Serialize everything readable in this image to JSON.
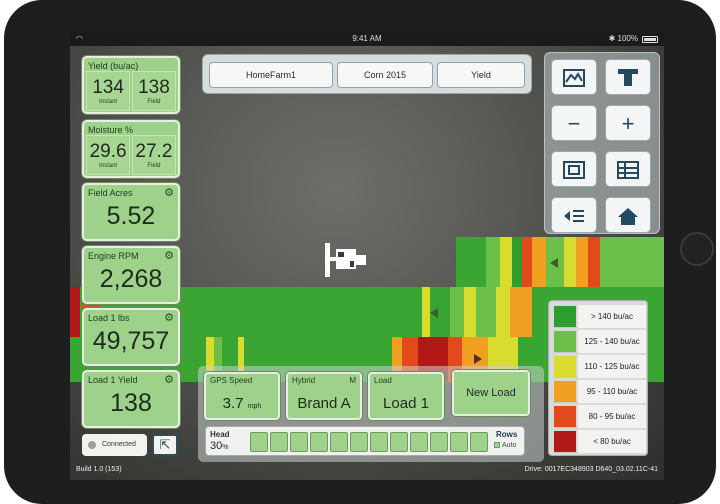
{
  "status": {
    "wifi": "◠",
    "time": "9:41 AM",
    "battery": "100%",
    "bluetooth": "✱"
  },
  "tiles": {
    "yield": {
      "title": "Yield (bu/ac)",
      "instant_value": "134",
      "instant_label": "Instant",
      "field_value": "138",
      "field_label": "Field"
    },
    "moisture": {
      "title": "Moisture %",
      "instant_value": "29.6",
      "instant_label": "Instant",
      "field_value": "27.2",
      "field_label": "Field"
    },
    "field_acres": {
      "title": "Field Acres",
      "value": "5.52"
    },
    "engine_rpm": {
      "title": "Engine RPM",
      "value": "2,268"
    },
    "load_lbs": {
      "title": "Load 1 lbs",
      "value": "49,757"
    },
    "load_yield": {
      "title": "Load 1 Yield",
      "value": "138"
    }
  },
  "connection": {
    "label": "Connected"
  },
  "topbar": {
    "farm": "HomeFarm1",
    "crop": "Corn 2015",
    "layer": "Yield"
  },
  "right_buttons": [
    "map-view-icon",
    "equipment-icon",
    "zoom-out-icon",
    "zoom-in-icon",
    "fit-view-icon",
    "table-icon",
    "layers-icon",
    "home-icon"
  ],
  "legend": [
    {
      "label": "> 140 bu/ac",
      "color": "#2e9e2e"
    },
    {
      "label": "125 - 140 bu/ac",
      "color": "#6cc04a"
    },
    {
      "label": "110 - 125 bu/ac",
      "color": "#d8dc2e"
    },
    {
      "label": "95 - 110 bu/ac",
      "color": "#f0a020"
    },
    {
      "label": "80 - 95 bu/ac",
      "color": "#e24a1c"
    },
    {
      "label": "< 80 bu/ac",
      "color": "#b21818"
    }
  ],
  "bottom": {
    "gps_label": "GPS Speed",
    "gps_value": "3.7",
    "gps_unit": "mph",
    "hybrid_label": "Hybrid",
    "hybrid_mode": "M",
    "hybrid_value": "Brand A",
    "load_label": "Load",
    "load_value": "Load 1",
    "new_load": "New Load",
    "head_label": "Head",
    "head_value": "30",
    "head_unit": "%",
    "rows_label": "Rows",
    "rows_mode": "Auto"
  },
  "footer": {
    "build": "Build 1.0 (153)",
    "drive": "Drive: 0017EC348903 D640_03.02.11C-41"
  }
}
